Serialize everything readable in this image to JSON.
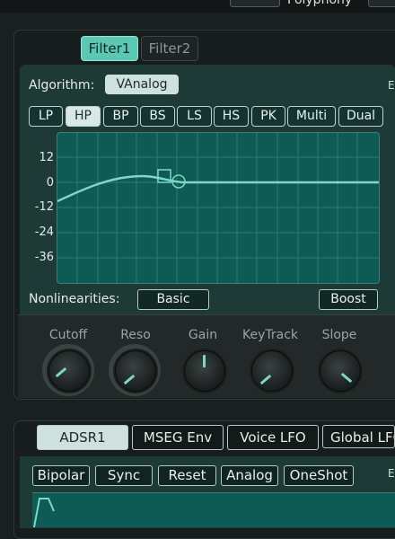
{
  "top": {
    "polyphony_label": "Polyphony"
  },
  "filter_tabs": [
    "Filter1",
    "Filter2"
  ],
  "algorithm": {
    "label": "Algorithm:",
    "value": "VAnalog"
  },
  "filter_types": [
    "LP",
    "HP",
    "BP",
    "BS",
    "LS",
    "HS",
    "PK",
    "Multi",
    "Dual"
  ],
  "selected_filter_type": "HP",
  "graph": {
    "y_ticks": [
      "12",
      "0",
      "-12",
      "-24",
      "-36"
    ]
  },
  "nonlinearities": {
    "label": "Nonlinearities:",
    "value": "Basic"
  },
  "boost_label": "Boost",
  "knobs": [
    {
      "label": "Cutoff",
      "level": 0.35
    },
    {
      "label": "Reso",
      "level": 0.2
    },
    {
      "label": "Gain",
      "level": 0.5
    },
    {
      "label": "KeyTrack",
      "level": 0.2
    },
    {
      "label": "Slope",
      "level": 0.75
    }
  ],
  "mod_tabs": [
    "ADSR1",
    "MSEG Env",
    "Voice LFO",
    "Global LFO"
  ],
  "env_options": [
    "Bipolar",
    "Sync",
    "Reset",
    "Analog",
    "OneShot"
  ],
  "colors": {
    "accent": "#5cc7b2",
    "graph_bg": "#0f5a55",
    "curve": "#7fd7c6"
  }
}
